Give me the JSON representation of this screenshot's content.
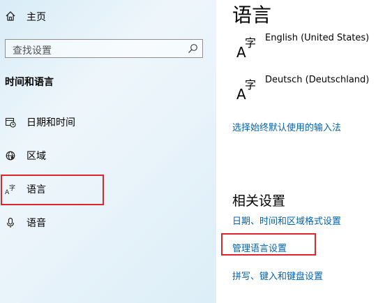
{
  "sidebar": {
    "home_label": "主页",
    "search_placeholder": "查找设置",
    "section_heading": "时间和语言",
    "items": [
      {
        "label": "日期和时间",
        "icon": "calendar-clock-icon"
      },
      {
        "label": "区域",
        "icon": "globe-icon"
      },
      {
        "label": "语言",
        "icon": "language-icon",
        "selected": true
      },
      {
        "label": "语音",
        "icon": "microphone-icon"
      }
    ]
  },
  "main": {
    "title": "语言",
    "languages": [
      {
        "name": "English (United States)",
        "icon": "language-glyph-icon"
      },
      {
        "name": "Deutsch (Deutschland)",
        "icon": "language-glyph-icon"
      }
    ],
    "input_method_link": "选择始终默认使用的输入法",
    "related_heading": "相关设置",
    "related_links": [
      "日期、时间和区域格式设置",
      "管理语言设置",
      "拼写、键入和键盘设置"
    ]
  },
  "colors": {
    "link": "#0063b1",
    "highlight": "#e0242c",
    "sidebar_bg": "#e8f3fa"
  }
}
